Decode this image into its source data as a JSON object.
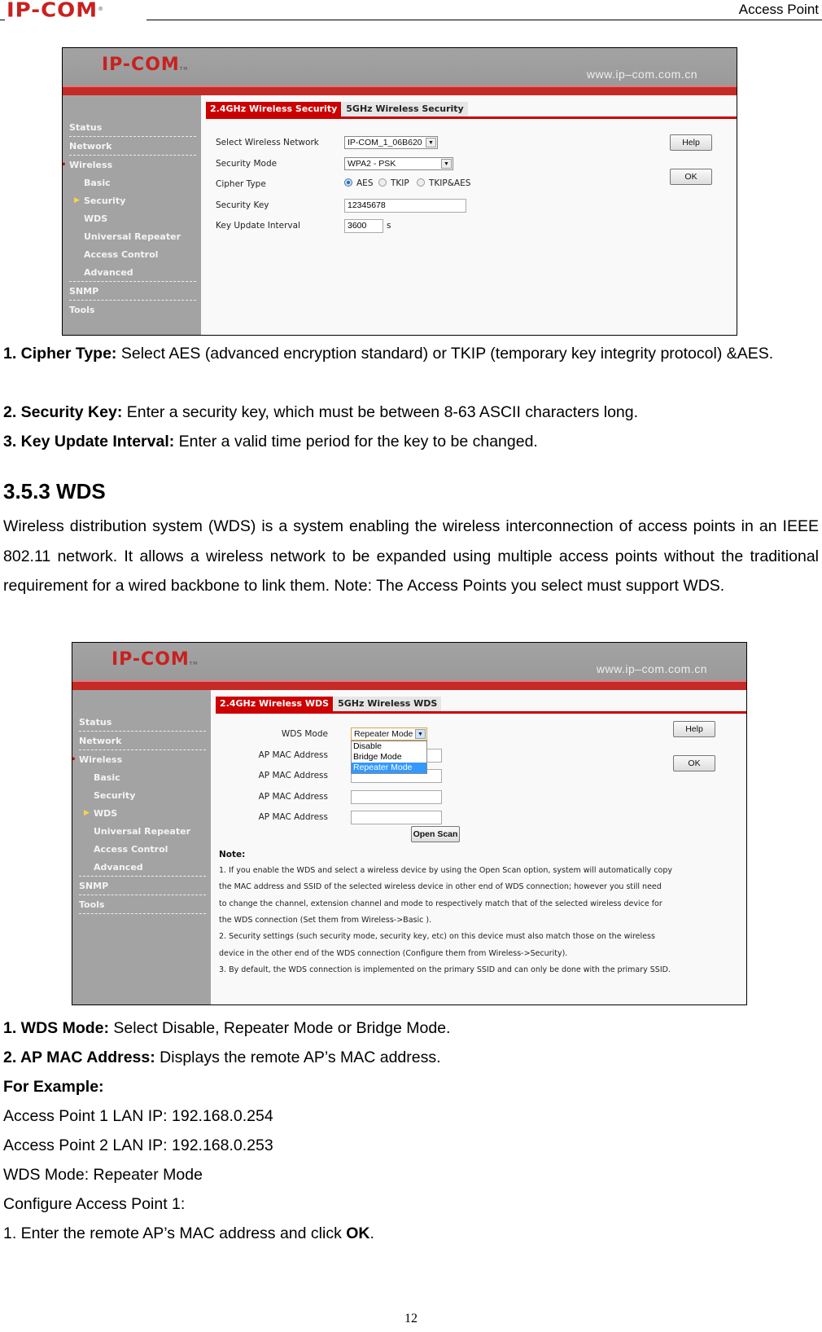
{
  "header": {
    "logo": "IP-COM",
    "logo_mark": "®",
    "title": "Access Point"
  },
  "screenshot1": {
    "banner_logo": "IP-COM",
    "banner_tm": "TM",
    "banner_url": "www.ip–com.com.cn",
    "tabs": [
      {
        "label": "2.4GHz Wireless Security",
        "active": true
      },
      {
        "label": "5GHz Wireless Security",
        "active": false
      }
    ],
    "nav": {
      "status": "Status",
      "network": "Network",
      "wireless": "Wireless",
      "basic": "Basic",
      "security": "Security",
      "wds": "WDS",
      "universal_repeater": "Universal Repeater",
      "access_control": "Access Control",
      "advanced": "Advanced",
      "snmp": "SNMP",
      "tools": "Tools",
      "active": "Security"
    },
    "form": {
      "select_network_label": "Select Wireless Network",
      "select_network_value": "IP-COM_1_06B620",
      "security_mode_label": "Security Mode",
      "security_mode_value": "WPA2 - PSK",
      "cipher_type_label": "Cipher Type",
      "cipher_options": [
        "AES",
        "TKIP",
        "TKIP&AES"
      ],
      "cipher_selected": "AES",
      "security_key_label": "Security Key",
      "security_key_value": "12345678",
      "key_update_label": "Key Update Interval",
      "key_update_value": "3600",
      "key_update_unit": "s"
    },
    "buttons": {
      "help": "Help",
      "ok": "OK"
    }
  },
  "section1": {
    "items": [
      {
        "label": "1. Cipher Type:",
        "text": " Select AES (advanced encryption standard) or TKIP (temporary key integrity protocol) &AES."
      },
      {
        "label": "2. Security Key:",
        "text": " Enter a security key, which must be between 8-63 ASCII characters long."
      },
      {
        "label": "3. Key Update Interval:",
        "text": " Enter a valid time period for the key to be changed."
      }
    ]
  },
  "section2": {
    "heading": "3.5.3 WDS",
    "intro": "Wireless distribution system (WDS) is a system enabling the wireless interconnection of access points in an IEEE 802.11 network. It allows a wireless network to be expanded using multiple access points without the traditional requirement for a wired backbone to link them. Note: The Access Points you select must support WDS."
  },
  "screenshot2": {
    "banner_logo": "IP-COM",
    "banner_tm": "TM",
    "banner_url": "www.ip–com.com.cn",
    "tabs": [
      {
        "label": "2.4GHz Wireless WDS",
        "active": true
      },
      {
        "label": "5GHz Wireless WDS",
        "active": false
      }
    ],
    "nav": {
      "status": "Status",
      "network": "Network",
      "wireless": "Wireless",
      "basic": "Basic",
      "security": "Security",
      "wds": "WDS",
      "universal_repeater": "Universal Repeater",
      "access_control": "Access Control",
      "advanced": "Advanced",
      "snmp": "SNMP",
      "tools": "Tools",
      "active": "WDS"
    },
    "form": {
      "wds_mode_label": "WDS Mode",
      "wds_mode_value": "Repeater Mode",
      "wds_mode_options": [
        "Disable",
        "Bridge Mode",
        "Repeater Mode"
      ],
      "wds_mode_highlighted": "Repeater Mode",
      "ap_mac_label": "AP MAC Address",
      "ap_mac_values": [
        "",
        "",
        "",
        ""
      ],
      "open_scan": "Open Scan"
    },
    "buttons": {
      "help": "Help",
      "ok": "OK"
    },
    "note": {
      "title": "Note:",
      "lines": [
        "1. If you enable the WDS and select a wireless device by using the Open Scan option, system will automatically copy",
        "the MAC address and SSID of the selected wireless device in other end of WDS connection; however you still need",
        "to change the channel, extension channel and mode to respectively match that of the selected wireless device for",
        "the WDS connection (Set them from Wireless->Basic ).",
        "2. Security settings (such security mode, security key, etc) on this device must also match those on the wireless",
        "device in the other end of the WDS connection (Configure them from Wireless->Security).",
        "3. By default, the WDS connection is implemented on the primary SSID and can only be done with the primary SSID."
      ]
    }
  },
  "section3": {
    "items": [
      {
        "label": "1. WDS Mode:",
        "text": " Select Disable, Repeater Mode or Bridge Mode."
      },
      {
        "label": "2. AP MAC Address:",
        "text": " Displays the remote AP’s MAC address."
      }
    ],
    "example_heading": "For Example:",
    "example_lines": [
      "Access Point 1 LAN IP: 192.168.0.254",
      "Access Point 2 LAN IP: 192.168.0.253",
      "WDS Mode: Repeater Mode",
      "Configure Access Point 1:"
    ],
    "step1_text": "1. Enter the remote AP’s MAC address and click ",
    "step1_bold": "OK",
    "step1_end": "."
  },
  "footer": {
    "page_number": "12"
  }
}
